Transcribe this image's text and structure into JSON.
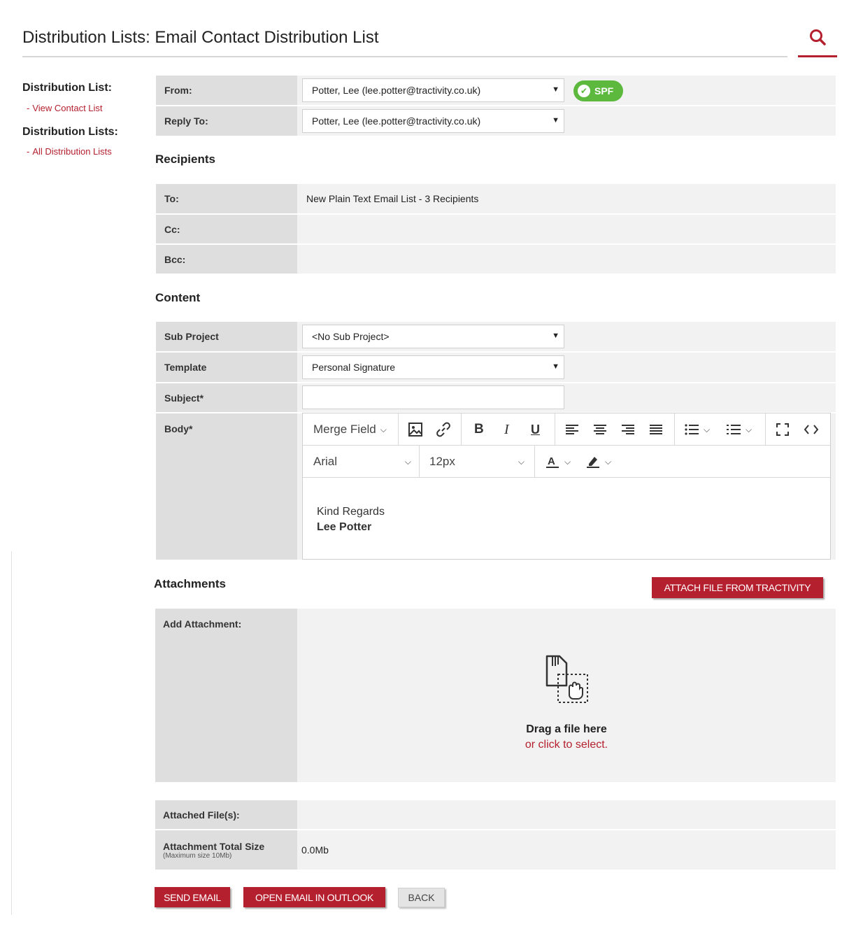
{
  "header": {
    "title": "Distribution Lists: Email Contact Distribution List",
    "search_icon": "search-icon"
  },
  "sidebar": {
    "heading1": "Distribution List:",
    "link1": "View Contact List",
    "heading2": "Distribution Lists:",
    "link2": "All Distribution Lists",
    "bullet": "-"
  },
  "sender": {
    "from_label": "From:",
    "from_value": "Potter, Lee (lee.potter@tractivity.co.uk)",
    "reply_label": "Reply To:",
    "reply_value": "Potter, Lee (lee.potter@tractivity.co.uk)",
    "spf_badge": "SPF",
    "spf_color": "#5cb93e"
  },
  "recipients": {
    "heading": "Recipients",
    "to_label": "To:",
    "to_value": "New Plain Text Email List - 3 Recipients",
    "cc_label": "Cc:",
    "bcc_label": "Bcc:"
  },
  "content": {
    "heading": "Content",
    "subproject_label": "Sub Project",
    "subproject_value": "<No Sub Project>",
    "template_label": "Template",
    "template_value": "Personal Signature",
    "subject_label": "Subject*",
    "subject_value": "",
    "body_label": "Body*"
  },
  "editor": {
    "merge_field": "Merge Field",
    "font_family": "Arial",
    "font_size": "12px",
    "body_line1": "Kind Regards",
    "body_line2": "Lee Potter",
    "icons": [
      "image-icon",
      "link-icon",
      "bold-icon",
      "italic-icon",
      "underline-icon",
      "align-left-icon",
      "align-center-icon",
      "align-right-icon",
      "align-justify-icon",
      "bullet-list-icon",
      "numbered-list-icon",
      "fullscreen-icon",
      "code-view-icon",
      "font-color-icon",
      "highlight-icon"
    ]
  },
  "attachments": {
    "heading": "Attachments",
    "attach_button": "ATTACH FILE FROM TRACTIVITY",
    "add_label": "Add Attachment:",
    "drop_title": "Drag a file here",
    "drop_sub": "or click to select.",
    "attached_label": "Attached File(s):",
    "size_label": "Attachment Total Size",
    "size_sub": "(Maximum size 10Mb)",
    "size_value": "0.0Mb"
  },
  "actions": {
    "send": "SEND EMAIL",
    "outlook": "OPEN EMAIL IN OUTLOOK",
    "back": "BACK"
  },
  "colors": {
    "accent": "#b5202f",
    "label_bg": "#dedede",
    "row_bg": "#f2f2f2"
  }
}
